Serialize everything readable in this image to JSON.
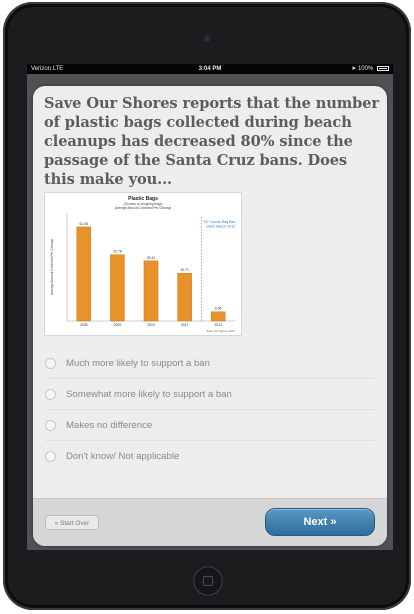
{
  "status_bar": {
    "carrier": "Verizon  LTE",
    "time": "3:04 PM",
    "battery": "100%"
  },
  "question": {
    "text": "Save Our Shores reports that the number of plastic bags collected during beach cleanups has decreased 80% since the passage of the Santa Cruz bans. Does this make you..."
  },
  "chart_data": {
    "type": "bar",
    "title": "Plastic Bags",
    "subtitle_1": "(Grocery or shopping bags)",
    "subtitle_2": "Average Amount Collected Per Cleanup",
    "ylabel": "Average Amount Collected Per Cleanup",
    "categories": [
      "2008",
      "2009",
      "2010",
      "2011",
      "2012"
    ],
    "values": [
      61.0,
      43.0,
      39.0,
      31.0,
      6.0
    ],
    "data_labels": [
      "61.05",
      "42.78",
      "39.41",
      "30.71",
      "5.96"
    ],
    "ylim": [
      0,
      70
    ],
    "annotation": "SC County Bag Ban starts March 2012",
    "source": "Save Our Shores 2012",
    "bar_color": "#e8922b",
    "annotation_color": "#3a7cc4"
  },
  "options": [
    {
      "label": "Much more likely to support a ban"
    },
    {
      "label": "Somewhat more likely to support a ban"
    },
    {
      "label": "Makes no difference"
    },
    {
      "label": "Don't know/ Not applicable"
    }
  ],
  "footer": {
    "start_over": "« Start Over",
    "next": "Next »"
  },
  "colors": {
    "accent": "#3a78a8",
    "question_text": "#5c5c5c",
    "card_bg": "#ededed"
  }
}
